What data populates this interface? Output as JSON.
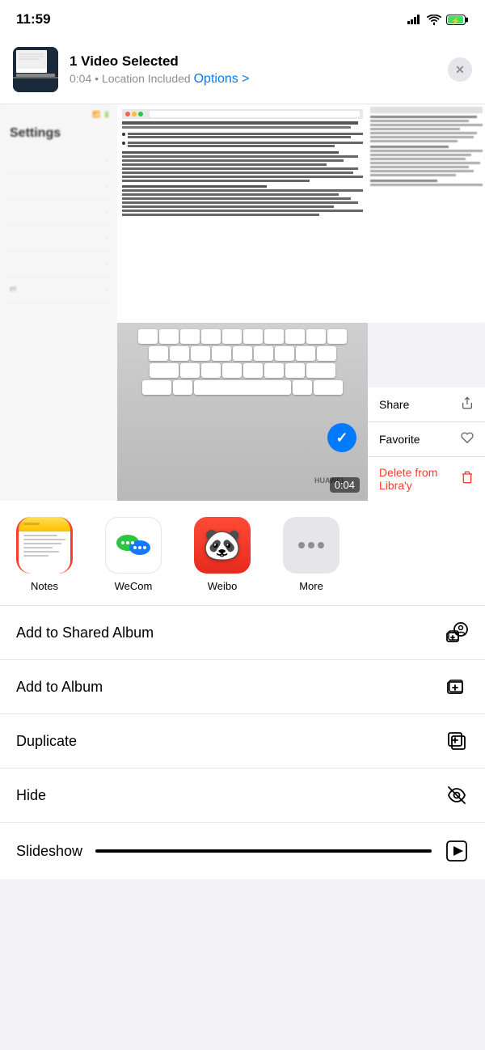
{
  "statusBar": {
    "time": "11:59",
    "signal": "signal-icon",
    "wifi": "wifi-icon",
    "battery": "battery-icon"
  },
  "shareHeader": {
    "title": "1 Video Selected",
    "duration": "0:04",
    "location": "Location Included",
    "optionsLabel": "Options >",
    "closeLabel": "×"
  },
  "appRow": {
    "items": [
      {
        "id": "notes",
        "label": "Notes",
        "highlighted": true
      },
      {
        "id": "wecom",
        "label": "WeCom",
        "highlighted": false
      },
      {
        "id": "weibo",
        "label": "Weibo",
        "highlighted": false
      },
      {
        "id": "more",
        "label": "More",
        "highlighted": false
      }
    ]
  },
  "actionList": {
    "items": [
      {
        "id": "add-shared-album",
        "label": "Add to Shared Album",
        "icon": "shared-album-icon"
      },
      {
        "id": "add-album",
        "label": "Add to Album",
        "icon": "album-icon"
      },
      {
        "id": "duplicate",
        "label": "Duplicate",
        "icon": "duplicate-icon"
      },
      {
        "id": "hide",
        "label": "Hide",
        "icon": "hide-icon"
      }
    ]
  },
  "slideshow": {
    "label": "Slideshow",
    "icon": "play-icon"
  },
  "contextMenu": {
    "items": [
      {
        "id": "share",
        "label": "Share",
        "icon": "share-icon",
        "isDelete": false
      },
      {
        "id": "favorite",
        "label": "Favorite",
        "icon": "heart-icon",
        "isDelete": false
      },
      {
        "id": "delete-library",
        "label": "Delete from Libra'y",
        "icon": "trash-icon",
        "isDelete": true
      }
    ]
  },
  "videoDuration": "0:04"
}
